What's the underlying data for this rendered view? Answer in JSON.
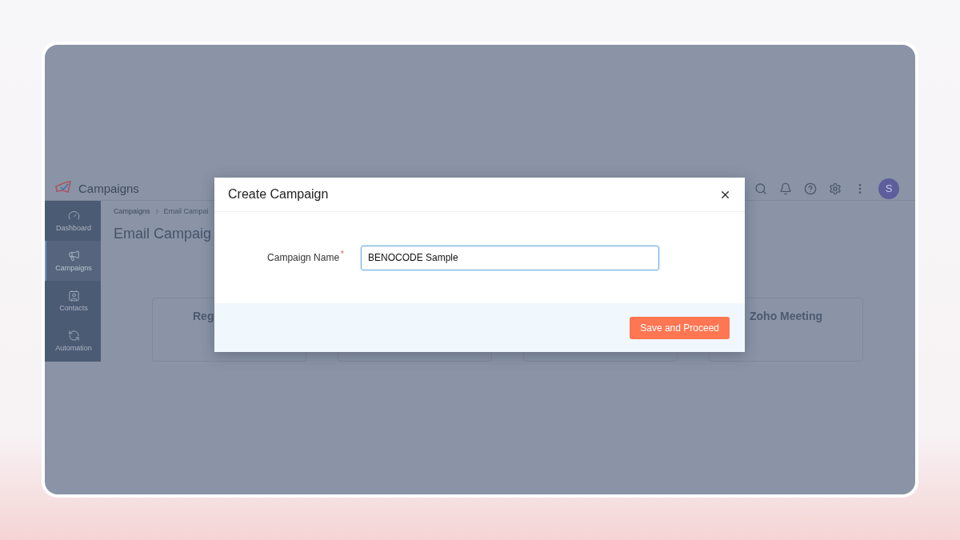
{
  "app": {
    "brand": "Campaigns",
    "avatar": "S",
    "sidebar": [
      {
        "label": "Dashboard",
        "selected": false
      },
      {
        "label": "Campaigns",
        "selected": true
      },
      {
        "label": "Contacts",
        "selected": false
      },
      {
        "label": "Automation",
        "selected": false
      }
    ],
    "breadcrumb": [
      "Campaigns",
      "Email Campai"
    ],
    "page_title": "Email Campaig",
    "cards": [
      {
        "title": "Reg"
      },
      {
        "title": "Zoho Meeting"
      }
    ]
  },
  "dialog": {
    "title": "Create Campaign",
    "field": {
      "label": "Campaign Name",
      "required_mark": "*",
      "value": "BENOCODE Sample"
    },
    "button": "Save and Proceed"
  }
}
